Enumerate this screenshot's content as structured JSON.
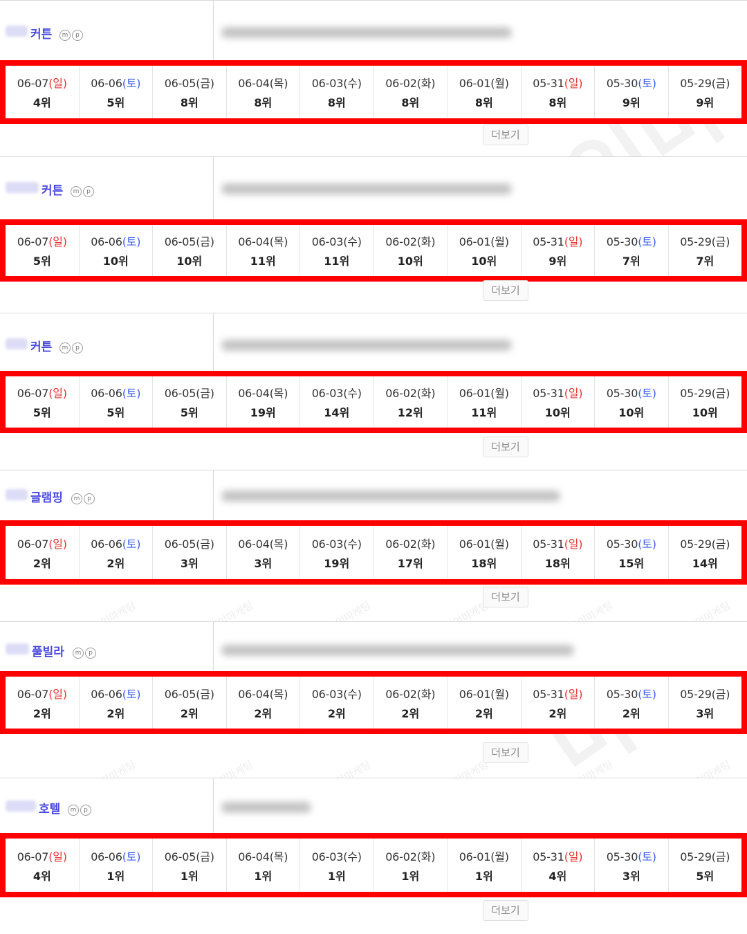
{
  "watermark": "다인마케팅",
  "more_label": "더보기",
  "mp_badges": [
    "m",
    "p"
  ],
  "colors": {
    "sunday": "#e8312f",
    "saturday": "#3a5ee8",
    "keyword": "#4a4adf",
    "highlight_border": "#ff0000"
  },
  "blocks": [
    {
      "keyword": "커튼",
      "dates": [
        {
          "date": "06-07",
          "dow": "일"
        },
        {
          "date": "06-06",
          "dow": "토"
        },
        {
          "date": "06-05",
          "dow": "금"
        },
        {
          "date": "06-04",
          "dow": "목"
        },
        {
          "date": "06-03",
          "dow": "수"
        },
        {
          "date": "06-02",
          "dow": "화"
        },
        {
          "date": "06-01",
          "dow": "월"
        },
        {
          "date": "05-31",
          "dow": "일"
        },
        {
          "date": "05-30",
          "dow": "토"
        },
        {
          "date": "05-29",
          "dow": "금"
        }
      ],
      "ranks": [
        "4위",
        "5위",
        "8위",
        "8위",
        "8위",
        "8위",
        "8위",
        "8위",
        "9위",
        "9위"
      ]
    },
    {
      "keyword": "커튼",
      "dates": [
        {
          "date": "06-07",
          "dow": "일"
        },
        {
          "date": "06-06",
          "dow": "토"
        },
        {
          "date": "06-05",
          "dow": "금"
        },
        {
          "date": "06-04",
          "dow": "목"
        },
        {
          "date": "06-03",
          "dow": "수"
        },
        {
          "date": "06-02",
          "dow": "화"
        },
        {
          "date": "06-01",
          "dow": "월"
        },
        {
          "date": "05-31",
          "dow": "일"
        },
        {
          "date": "05-30",
          "dow": "토"
        },
        {
          "date": "05-29",
          "dow": "금"
        }
      ],
      "ranks": [
        "5위",
        "10위",
        "10위",
        "11위",
        "11위",
        "10위",
        "10위",
        "9위",
        "7위",
        "7위"
      ]
    },
    {
      "keyword": "커튼",
      "dates": [
        {
          "date": "06-07",
          "dow": "일"
        },
        {
          "date": "06-06",
          "dow": "토"
        },
        {
          "date": "06-05",
          "dow": "금"
        },
        {
          "date": "06-04",
          "dow": "목"
        },
        {
          "date": "06-03",
          "dow": "수"
        },
        {
          "date": "06-02",
          "dow": "화"
        },
        {
          "date": "06-01",
          "dow": "월"
        },
        {
          "date": "05-31",
          "dow": "일"
        },
        {
          "date": "05-30",
          "dow": "토"
        },
        {
          "date": "05-29",
          "dow": "금"
        }
      ],
      "ranks": [
        "5위",
        "5위",
        "5위",
        "19위",
        "14위",
        "12위",
        "11위",
        "10위",
        "10위",
        "10위"
      ]
    },
    {
      "keyword": "글램핑",
      "dates": [
        {
          "date": "06-07",
          "dow": "일"
        },
        {
          "date": "06-06",
          "dow": "토"
        },
        {
          "date": "06-05",
          "dow": "금"
        },
        {
          "date": "06-04",
          "dow": "목"
        },
        {
          "date": "06-03",
          "dow": "수"
        },
        {
          "date": "06-02",
          "dow": "화"
        },
        {
          "date": "06-01",
          "dow": "월"
        },
        {
          "date": "05-31",
          "dow": "일"
        },
        {
          "date": "05-30",
          "dow": "토"
        },
        {
          "date": "05-29",
          "dow": "금"
        }
      ],
      "ranks": [
        "2위",
        "2위",
        "3위",
        "3위",
        "19위",
        "17위",
        "18위",
        "18위",
        "15위",
        "14위"
      ]
    },
    {
      "keyword": "풀빌라",
      "dates": [
        {
          "date": "06-07",
          "dow": "일"
        },
        {
          "date": "06-06",
          "dow": "토"
        },
        {
          "date": "06-05",
          "dow": "금"
        },
        {
          "date": "06-04",
          "dow": "목"
        },
        {
          "date": "06-03",
          "dow": "수"
        },
        {
          "date": "06-02",
          "dow": "화"
        },
        {
          "date": "06-01",
          "dow": "월"
        },
        {
          "date": "05-31",
          "dow": "일"
        },
        {
          "date": "05-30",
          "dow": "토"
        },
        {
          "date": "05-29",
          "dow": "금"
        }
      ],
      "ranks": [
        "2위",
        "2위",
        "2위",
        "2위",
        "2위",
        "2위",
        "2위",
        "2위",
        "2위",
        "3위"
      ]
    },
    {
      "keyword": "호텔",
      "dates": [
        {
          "date": "06-07",
          "dow": "일"
        },
        {
          "date": "06-06",
          "dow": "토"
        },
        {
          "date": "06-05",
          "dow": "금"
        },
        {
          "date": "06-04",
          "dow": "목"
        },
        {
          "date": "06-03",
          "dow": "수"
        },
        {
          "date": "06-02",
          "dow": "화"
        },
        {
          "date": "06-01",
          "dow": "월"
        },
        {
          "date": "05-31",
          "dow": "일"
        },
        {
          "date": "05-30",
          "dow": "토"
        },
        {
          "date": "05-29",
          "dow": "금"
        }
      ],
      "ranks": [
        "4위",
        "1위",
        "1위",
        "1위",
        "1위",
        "1위",
        "1위",
        "4위",
        "3위",
        "5위"
      ]
    }
  ]
}
